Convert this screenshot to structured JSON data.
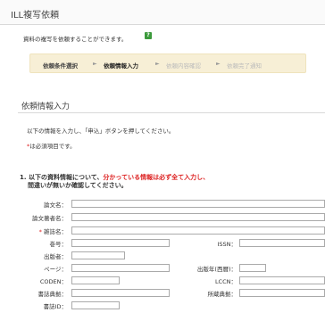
{
  "header": {
    "title": "ILL複写依頼"
  },
  "intro": {
    "text": "資料の複写を依頼することができます。",
    "help_icon": "help-icon",
    "help_glyph": "?"
  },
  "steps": [
    {
      "label": "依頼条件選択",
      "state": "done"
    },
    {
      "label": "依頼情報入力",
      "state": "current"
    },
    {
      "label": "依頼内容確認",
      "state": "future"
    },
    {
      "label": "依頼完了通知",
      "state": "future"
    }
  ],
  "step_arrow": "►",
  "section": {
    "title": "依頼情報入力"
  },
  "instructions": {
    "line1": "以下の情報を入力し、「申込」ボタンを押してください。",
    "required_mark": "*",
    "line2": "は必須項目です。"
  },
  "question1": {
    "prefix": "1. 以下の資料情報について、",
    "highlight": "分かっている情報は必ず全て入力し、",
    "suffix": "間違いが無いか確認してください。"
  },
  "fields": {
    "article_title": {
      "label": "論文名：",
      "value": ""
    },
    "article_author": {
      "label": "論文著者名：",
      "value": ""
    },
    "journal_title": {
      "label": "雑誌名：",
      "required_mark": "*",
      "value": ""
    },
    "volume": {
      "label": "巻号：",
      "value": ""
    },
    "issn": {
      "label": "ISSN：",
      "value": ""
    },
    "publisher": {
      "label": "出版者：",
      "value": ""
    },
    "pages": {
      "label": "ページ：",
      "value": ""
    },
    "pub_year": {
      "label": "出版年(西暦)：",
      "value": ""
    },
    "coden": {
      "label": "CODEN：",
      "value": ""
    },
    "lccn": {
      "label": "LCCN：",
      "value": ""
    },
    "biblio_id_1": {
      "label": "書誌典拠：",
      "value": ""
    },
    "holding_id": {
      "label": "所蔵典拠：",
      "value": ""
    },
    "biblio_id": {
      "label": "書誌ID：",
      "value": ""
    }
  }
}
